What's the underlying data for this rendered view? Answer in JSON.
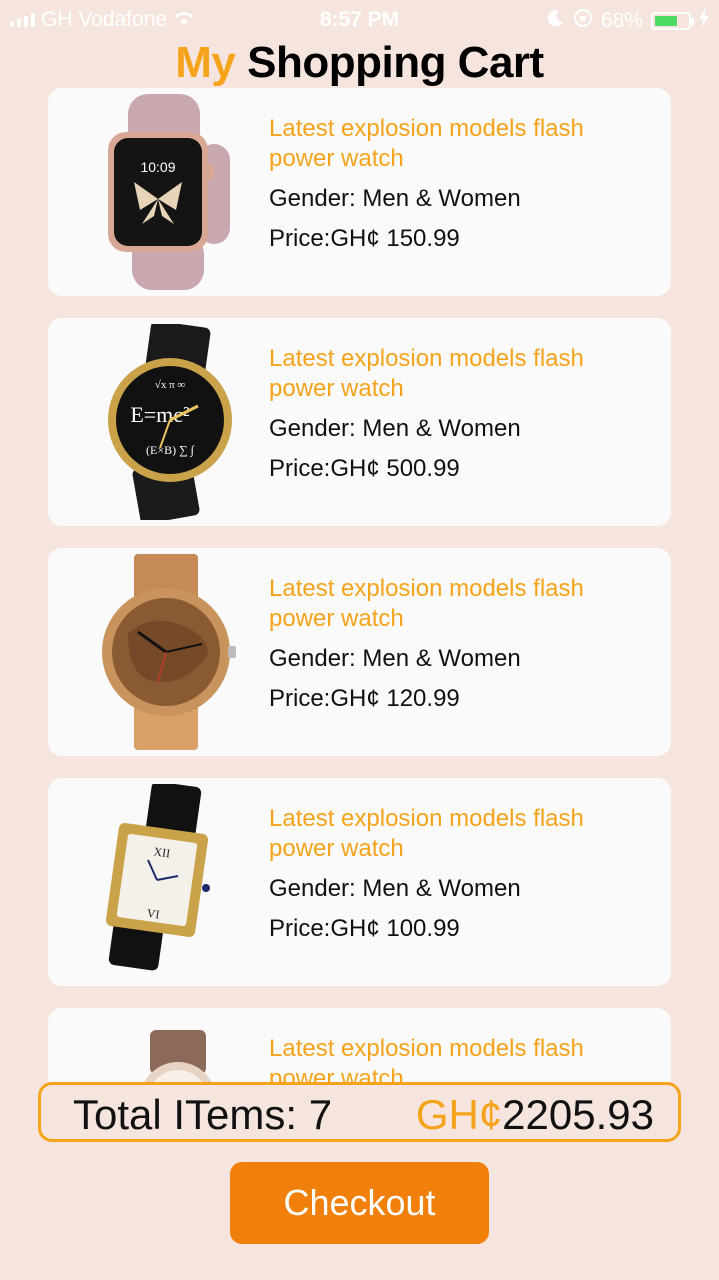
{
  "status_bar": {
    "carrier": "GH Vodafone",
    "time": "8:57 PM",
    "battery": "68%",
    "battery_level": 0.68
  },
  "header": {
    "title_accent": "My",
    "title_rest": "Shopping Cart"
  },
  "cart": {
    "items": [
      {
        "name": "Latest explosion models flash power watch",
        "gender": "Gender: Men & Women",
        "price": "Price:GH¢ 150.99",
        "image": "rose-gold-smartwatch-image"
      },
      {
        "name": "Latest explosion models flash power watch",
        "gender": "Gender: Men & Women",
        "price": "Price:GH¢ 500.99",
        "image": "emc2-black-watch-image"
      },
      {
        "name": "Latest explosion models flash power watch",
        "gender": "Gender: Men & Women",
        "price": "Price:GH¢ 120.99",
        "image": "wooden-watch-image"
      },
      {
        "name": "Latest explosion models flash power watch",
        "gender": "Gender: Men & Women",
        "price": "Price:GH¢ 100.99",
        "image": "gold-tank-watch-image"
      },
      {
        "name": "Latest explosion models flash power watch",
        "gender": "",
        "price": "",
        "image": "jeweled-watch-image"
      }
    ]
  },
  "summary": {
    "total_items": "Total ITems: 7",
    "currency": "GH¢",
    "amount": "2205.93"
  },
  "checkout_label": "Checkout",
  "colors": {
    "accent": "#f5a31a",
    "button": "#f0800a",
    "background": "#f5e5de",
    "card": "#fafafa"
  }
}
